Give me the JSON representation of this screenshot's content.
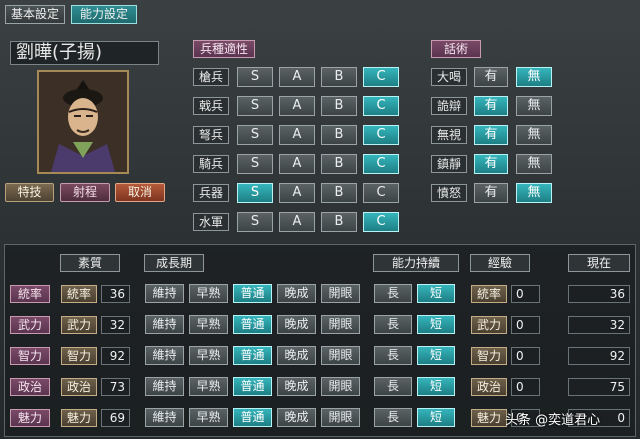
{
  "tabs": [
    {
      "label": "基本設定",
      "active": false
    },
    {
      "label": "能力設定",
      "active": true
    }
  ],
  "officer": {
    "name": "劉曄(子揚)"
  },
  "actions": {
    "skill": "特技",
    "range": "射程",
    "cancel": "取消"
  },
  "troops": {
    "title": "兵種適性",
    "grades": [
      "S",
      "A",
      "B",
      "C"
    ],
    "rows": [
      {
        "label": "槍兵",
        "selected": "C"
      },
      {
        "label": "戟兵",
        "selected": "C"
      },
      {
        "label": "弩兵",
        "selected": "C"
      },
      {
        "label": "騎兵",
        "selected": "C"
      },
      {
        "label": "兵器",
        "selected": "S"
      },
      {
        "label": "水軍",
        "selected": "C"
      }
    ]
  },
  "tactics": {
    "title": "話術",
    "yes": "有",
    "no": "無",
    "rows": [
      {
        "label": "大喝",
        "selected": "無"
      },
      {
        "label": "詭辯",
        "selected": "有"
      },
      {
        "label": "無視",
        "selected": "有"
      },
      {
        "label": "鎮靜",
        "selected": "有"
      },
      {
        "label": "憤怒",
        "selected": "無"
      }
    ]
  },
  "stats": {
    "headers": {
      "quality": "素質",
      "growth": "成長期",
      "duration": "能力持續",
      "experience": "經驗",
      "current": "現在"
    },
    "growth_options": [
      "維持",
      "早熟",
      "普通",
      "晚成",
      "開眼"
    ],
    "duration_options": [
      "長",
      "短"
    ],
    "rows": [
      {
        "label": "統率",
        "quality": 36,
        "growth": "普通",
        "duration": "短",
        "experience": 0,
        "current": 36
      },
      {
        "label": "武力",
        "quality": 32,
        "growth": "普通",
        "duration": "短",
        "experience": 0,
        "current": 32
      },
      {
        "label": "智力",
        "quality": 92,
        "growth": "普通",
        "duration": "短",
        "experience": 0,
        "current": 92
      },
      {
        "label": "政治",
        "quality": 73,
        "growth": "普通",
        "duration": "短",
        "experience": 0,
        "current": 75
      },
      {
        "label": "魅力",
        "quality": 69,
        "growth": "普通",
        "duration": "短",
        "experience": 0,
        "current": "0"
      }
    ]
  },
  "watermark": "头条 @奕道君心",
  "colors": {
    "accent": "#2a9fa5",
    "label_mauve": "#6a3e5a",
    "button_brown": "#5e5140"
  }
}
